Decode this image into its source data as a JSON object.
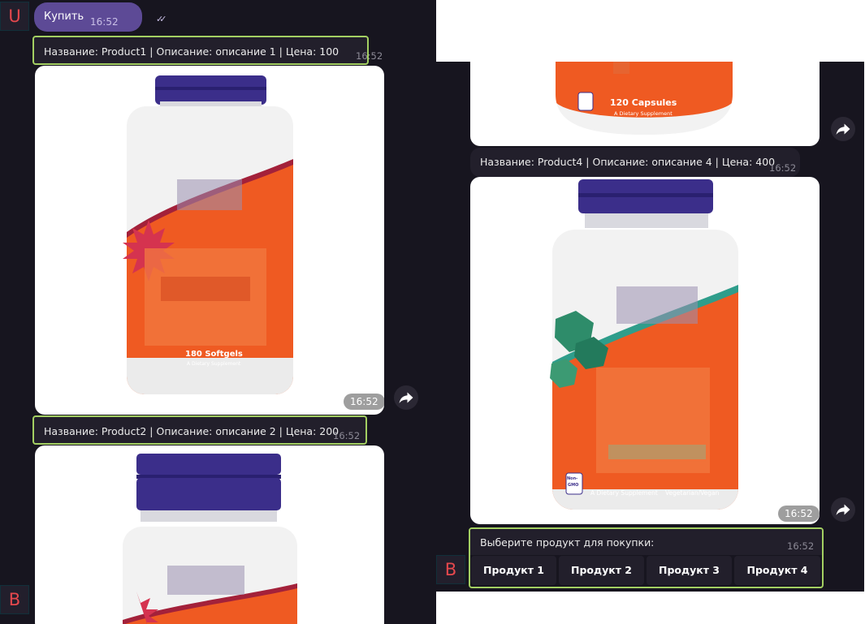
{
  "chat": {
    "sent_message": {
      "text": "Купить",
      "time": "16:52",
      "read_icon": "double-check-icon"
    },
    "user_avatar_letter": "U",
    "bot_avatar_letter": "B",
    "products": [
      {
        "caption": "Название: Product1 | Описание: описание 1 | Цена: 100",
        "caption_time": "16:52",
        "label": "180 Softgels",
        "sublabel": "A Dietary Supplement",
        "image_time": "16:52"
      },
      {
        "caption": "Название: Product2 | Описание: описание 2 | Цена: 200",
        "caption_time": "16:52"
      },
      {
        "label": "120 Capsules",
        "sublabel": "A Dietary Supplement"
      },
      {
        "caption": "Название: Product4 | Описание: описание 4 | Цена: 400",
        "caption_time": "16:52",
        "label_left": "A Dietary Supplement",
        "label_right": "Vegetarian/Vegan",
        "badge_top": "Non-",
        "badge_bottom": "GMO",
        "image_time": "16:52"
      }
    ],
    "menu": {
      "prompt": "Выберите продукт для покупки:",
      "time": "16:52",
      "buttons": [
        "Продукт 1",
        "Продукт 2",
        "Продукт 3",
        "Продукт 4"
      ]
    },
    "colors": {
      "accent_border": "#a3cf62",
      "sent_bubble": "#5d4a96",
      "background": "#17151f",
      "avatar_letter": "#e5484d",
      "label_orange": "#ef5a22",
      "cap_navy": "#3b2e8a"
    },
    "forward_icon": "forward-arrow-icon"
  }
}
